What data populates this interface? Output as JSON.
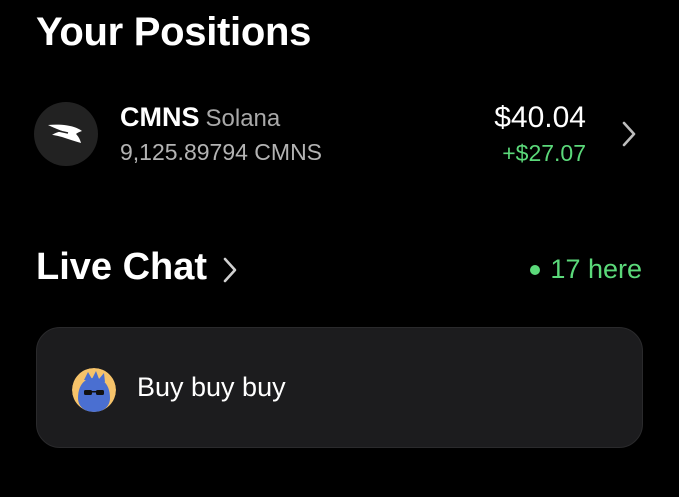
{
  "positions": {
    "title": "Your Positions",
    "items": [
      {
        "symbol": "CMNS",
        "chain": "Solana",
        "amount": "9,125.89794 CMNS",
        "value": "$40.04",
        "change": "+$27.07",
        "logo_icon": "bird-logo-icon"
      }
    ]
  },
  "live_chat": {
    "title": "Live Chat",
    "presence": "17 here",
    "messages": [
      {
        "text": "Buy buy buy",
        "avatar_icon": "sunglasses-avatar-icon"
      }
    ]
  },
  "colors": {
    "background": "#000000",
    "positive": "#5bd97a",
    "card": "#1c1c1e",
    "muted_text": "#b3b3b3"
  }
}
